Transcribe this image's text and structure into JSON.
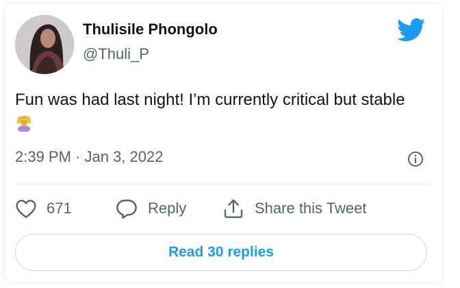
{
  "tweet": {
    "display_name": "Thulisile Phongolo",
    "handle": "@Thuli_P",
    "text": "Fun was had last night! I’m currently critical but stable",
    "emoji": "person-gesturing-ok-emoji",
    "timestamp": "2:39 PM · Jan 3, 2022"
  },
  "actions": {
    "like_count": "671",
    "reply_label": "Reply",
    "share_label": "Share this Tweet"
  },
  "read_replies_label": "Read 30 replies",
  "icons": {
    "brand": "twitter-bird-icon",
    "info": "info-icon",
    "like": "heart-icon",
    "reply": "reply-bubble-icon",
    "share": "share-upload-icon"
  },
  "colors": {
    "brand": "#1d9bf0",
    "text": "#0f1419",
    "muted": "#536471",
    "border": "#e6ecf0"
  }
}
